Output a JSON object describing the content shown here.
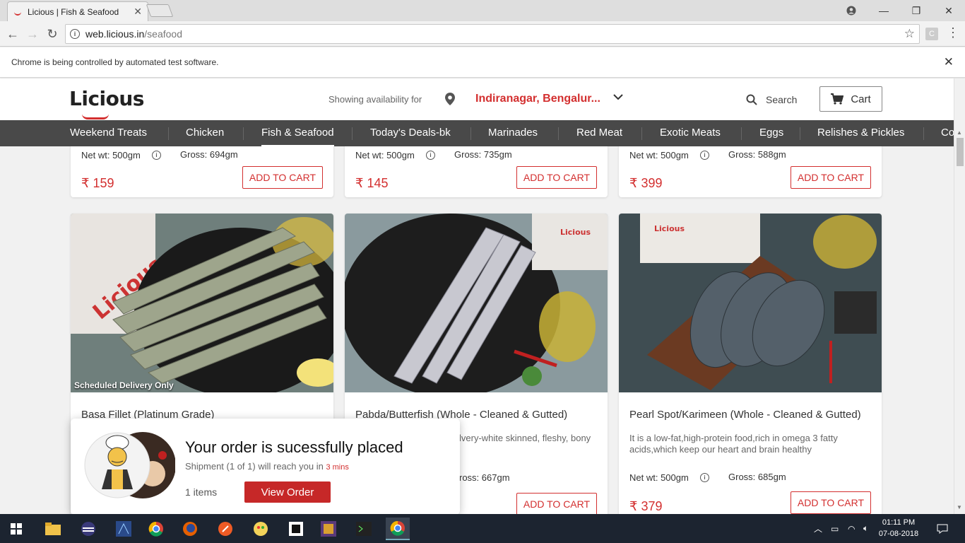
{
  "browser": {
    "tab_title": "Licious | Fish & Seafood",
    "url_host": "web.licious.in",
    "url_path": "/seafood",
    "ext_label": "C",
    "automation_message": "Chrome is being controlled by automated test software."
  },
  "header": {
    "logo": "Licious",
    "availability_label": "Showing availability for",
    "location": "Indiranagar, Bengalur...",
    "search_label": "Search",
    "cart_label": "Cart"
  },
  "nav": {
    "items": [
      {
        "label": "Weekend Treats"
      },
      {
        "label": "Chicken"
      },
      {
        "label": "Fish & Seafood"
      },
      {
        "label": "Today's Deals-bk"
      },
      {
        "label": "Marinades"
      },
      {
        "label": "Red Meat"
      },
      {
        "label": "Exotic Meats"
      },
      {
        "label": "Eggs"
      },
      {
        "label": "Relishes & Pickles"
      },
      {
        "label": "Co"
      }
    ],
    "active_index": 2
  },
  "top_cards": [
    {
      "net_wt": "Net wt: 500gm",
      "gross": "Gross: 694gm",
      "price": "₹ 159",
      "add_label": "ADD TO CART"
    },
    {
      "net_wt": "Net wt: 500gm",
      "gross": "Gross: 735gm",
      "price": "₹ 145",
      "add_label": "ADD TO CART"
    },
    {
      "net_wt": "Net wt: 500gm",
      "gross": "Gross: 588gm",
      "price": "₹ 399",
      "add_label": "ADD TO CART"
    }
  ],
  "cards": [
    {
      "title": "Basa Fillet (Platinum Grade)",
      "badge": "Scheduled Delivery Only",
      "desc": "",
      "net_wt": "",
      "gross": "",
      "price": "",
      "add_label": ""
    },
    {
      "title": "Pabda/Butterfish (Whole - Cleaned & Gutted)",
      "desc": "lvery-white skinned, fleshy, bony",
      "net_wt": "",
      "gross": "ross: 667gm",
      "price": "",
      "add_label": "ADD TO CART"
    },
    {
      "title": "Pearl Spot/Karimeen (Whole - Cleaned & Gutted)",
      "desc": "It is a low-fat,high-protein food,rich in omega 3 fatty acids,which keep our heart and brain healthy",
      "net_wt": "Net wt: 500gm",
      "gross": "Gross: 685gm",
      "price": "₹ 379",
      "add_label": "ADD TO CART"
    }
  ],
  "toast": {
    "title": "Your order is sucessfully placed",
    "sub_prefix": "Shipment (1 of 1) will reach you in",
    "sub_time": "3 mins",
    "items": "1 items",
    "button": "View Order"
  },
  "taskbar": {
    "time": "01:11 PM",
    "date": "07-08-2018"
  },
  "colors": {
    "brand_red": "#d32f2f",
    "nav_bg": "#494949",
    "taskbar_bg": "#1c2430"
  }
}
